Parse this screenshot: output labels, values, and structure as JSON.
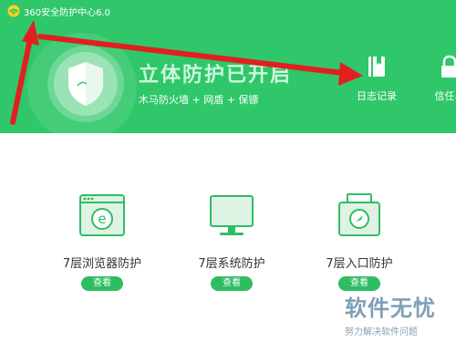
{
  "app": {
    "title": "360安全防护中心6.0",
    "accent": "#2fc76a",
    "button_color": "#2fbd62"
  },
  "status": {
    "title": "立体防护已开启",
    "subtitle": "木马防火墙 + 网盾 + 保镖"
  },
  "top_tools": [
    {
      "label": "日志记录",
      "icon": "log-book-icon"
    },
    {
      "label": "信任与",
      "icon": "lock-icon"
    }
  ],
  "modules": [
    {
      "label": "7层浏览器防护",
      "button": "查看",
      "icon": "browser-window-icon"
    },
    {
      "label": "7层系统防护",
      "button": "查看",
      "icon": "monitor-icon"
    },
    {
      "label": "7层入口防护",
      "button": "查看",
      "icon": "entry-gate-icon"
    }
  ],
  "watermark": {
    "title": "软件无忧",
    "subtitle": "努力解决软件问题"
  },
  "annotation": {
    "arrow_color": "#e02020"
  }
}
